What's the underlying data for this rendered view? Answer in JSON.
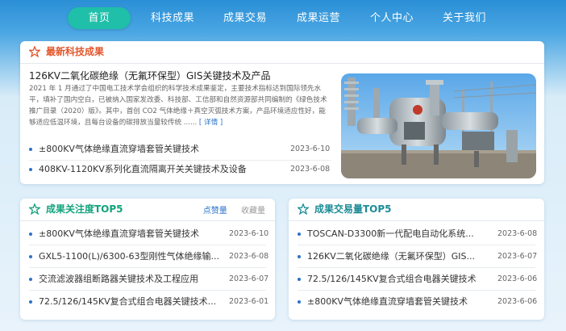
{
  "nav": {
    "items": [
      {
        "label": "首页",
        "active": true
      },
      {
        "label": "科技成果",
        "active": false
      },
      {
        "label": "成果交易",
        "active": false
      },
      {
        "label": "成果运营",
        "active": false
      },
      {
        "label": "个人中心",
        "active": false
      },
      {
        "label": "关于我们",
        "active": false
      }
    ]
  },
  "latest": {
    "title": "最新科技成果",
    "featured_title": "126KV二氧化碳绝缘（无氟环保型）GIS关键技术及产品",
    "featured_desc": "2021 年 1 月通过了中国电工技术学会组织的科学技术成果鉴定，主要技术指标达到国际领先水平，填补了国内空白，已被纳入国家发改委、科技部、工信部和自然资源部共同编制的《绿色技术推广目录（2020）版》。其中，首创 CO2 气体绝缘＋真空灭弧技术方案，产品环境适应性好，能够适应低温环境，且每台设备的碳排放当量较传统 ......",
    "detail_label": "[ 详情 ]",
    "items": [
      {
        "text": "±800KV气体绝缘直流穿墙套管关键技术",
        "date": "2023-6-10"
      },
      {
        "text": "408KV-1120KV系列化直流隔离开关关键技术及设备",
        "date": "2023-6-08"
      }
    ]
  },
  "attention": {
    "title": "成果关注度TOP5",
    "tab_likes": "点赞量",
    "tab_favorites": "收藏量",
    "items": [
      {
        "text": "±800KV气体绝缘直流穿墙套管关键技术",
        "date": "2023-6-10"
      },
      {
        "text": "GXL5-1100(L)/6300-63型刚性气体绝缘输...",
        "date": "2023-6-08"
      },
      {
        "text": "交流滤波器组断路器关键技术及工程应用",
        "date": "2023-6-07"
      },
      {
        "text": "72.5/126/145KV复合式组合电器关键技术...",
        "date": "2023-6-01"
      }
    ]
  },
  "trade": {
    "title": "成果交易量TOP5",
    "items": [
      {
        "text": "TOSCAN-D3300新一代配电自动化系统...",
        "date": "2023-6-08"
      },
      {
        "text": "126KV二氧化碳绝缘（无氟环保型）GIS...",
        "date": "2023-6-07"
      },
      {
        "text": "72.5/126/145KV复合式组合电器关键技术",
        "date": "2023-6-06"
      },
      {
        "text": "±800KV气体绝缘直流穿墙套管关键技术",
        "date": "2023-6-06"
      }
    ]
  },
  "colors": {
    "nav_active": "#1fbfa9",
    "accent_red": "#e2562b",
    "accent_green": "#12a37d",
    "accent_teal": "#1c8c97",
    "link_blue": "#2a72c9"
  }
}
